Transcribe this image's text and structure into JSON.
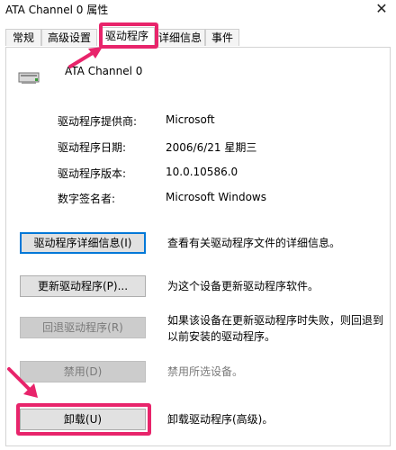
{
  "window": {
    "title": "ATA Channel 0 属性",
    "close_glyph": "✕"
  },
  "tabs": [
    {
      "label": "常规",
      "active": false
    },
    {
      "label": "高级设置",
      "active": false
    },
    {
      "label": "驱动程序",
      "active": true
    },
    {
      "label": "详细信息",
      "active": false
    },
    {
      "label": "事件",
      "active": false
    }
  ],
  "device": {
    "name": "ATA Channel 0",
    "icon": "controller-icon"
  },
  "driver_info": [
    {
      "label": "驱动程序提供商:",
      "value": "Microsoft"
    },
    {
      "label": "驱动程序日期:",
      "value": "2006/6/21 星期三"
    },
    {
      "label": "驱动程序版本:",
      "value": "10.0.10586.0"
    },
    {
      "label": "数字签名者:",
      "value": "Microsoft Windows"
    }
  ],
  "actions": {
    "details": {
      "label": "驱动程序详细信息(I)",
      "description": "查看有关驱动程序文件的详细信息。",
      "enabled": true
    },
    "update": {
      "label": "更新驱动程序(P)...",
      "description": "为这个设备更新驱动程序软件。",
      "enabled": true
    },
    "rollback": {
      "label": "回退驱动程序(R)",
      "description": "如果该设备在更新驱动程序时失败，则回退到以前安装的驱动程序。",
      "enabled": false
    },
    "disable": {
      "label": "禁用(D)",
      "description": "禁用所选设备。",
      "enabled": false
    },
    "uninstall": {
      "label": "卸载(U)",
      "description": "卸载驱动程序(高级)。",
      "enabled": true
    }
  },
  "colors": {
    "highlight": "#e8246b",
    "focus": "#0078d7",
    "button_bg": "#e1e1e1",
    "disabled_bg": "#cccccc",
    "disabled_text": "#7a7a7a"
  }
}
